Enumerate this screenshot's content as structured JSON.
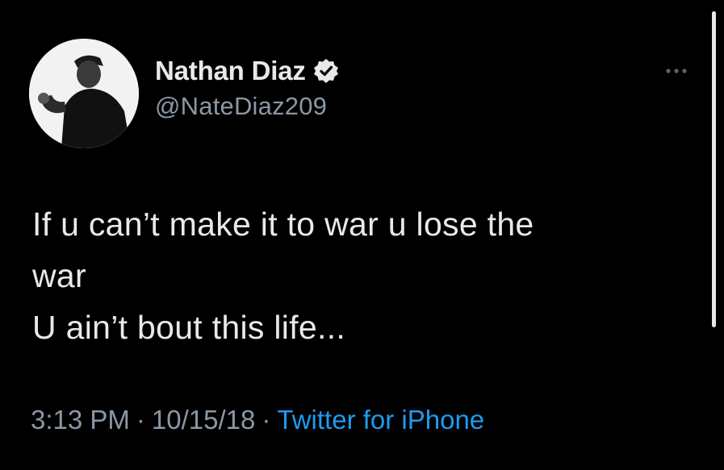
{
  "author": {
    "display_name": "Nathan Diaz",
    "handle": "@NateDiaz209",
    "verified": true
  },
  "tweet": {
    "lines": [
      "If u can’t make it to war u lose the",
      "war",
      "U ain’t bout this life..."
    ]
  },
  "meta": {
    "time": "3:13 PM",
    "separator": "·",
    "date": "10/15/18",
    "source": "Twitter for iPhone"
  },
  "icons": {
    "verified": "verified-badge-icon",
    "more": "more-options-icon"
  },
  "colors": {
    "background": "#000000",
    "text": "#e7e9ea",
    "secondary": "#8b98a5",
    "link": "#1d9bf0"
  }
}
